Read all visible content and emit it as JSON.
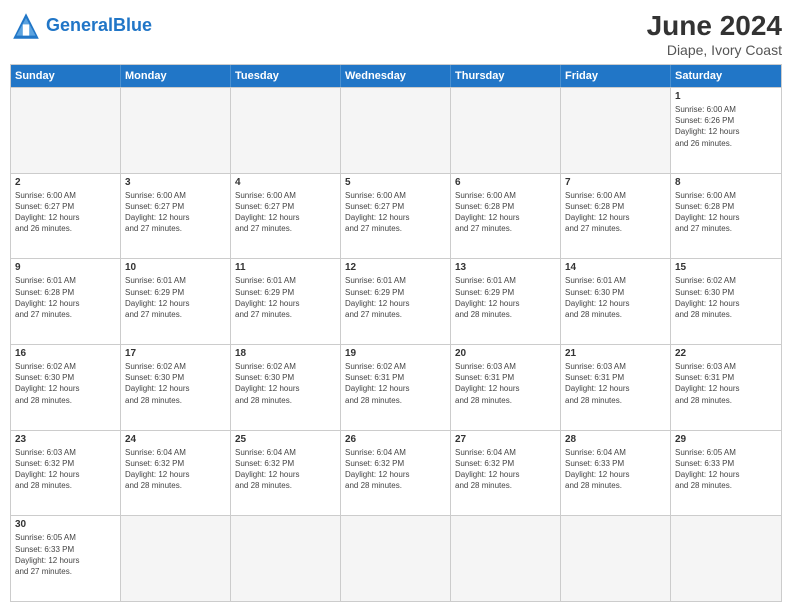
{
  "header": {
    "logo_general": "General",
    "logo_blue": "Blue",
    "title": "June 2024",
    "location": "Diape, Ivory Coast"
  },
  "days_of_week": [
    "Sunday",
    "Monday",
    "Tuesday",
    "Wednesday",
    "Thursday",
    "Friday",
    "Saturday"
  ],
  "rows": [
    {
      "cells": [
        {
          "day": "",
          "info": "",
          "empty": true
        },
        {
          "day": "",
          "info": "",
          "empty": true
        },
        {
          "day": "",
          "info": "",
          "empty": true
        },
        {
          "day": "",
          "info": "",
          "empty": true
        },
        {
          "day": "",
          "info": "",
          "empty": true
        },
        {
          "day": "",
          "info": "",
          "empty": true
        },
        {
          "day": "1",
          "info": "Sunrise: 6:00 AM\nSunset: 6:26 PM\nDaylight: 12 hours\nand 26 minutes.",
          "empty": false
        }
      ]
    },
    {
      "cells": [
        {
          "day": "2",
          "info": "Sunrise: 6:00 AM\nSunset: 6:27 PM\nDaylight: 12 hours\nand 26 minutes.",
          "empty": false
        },
        {
          "day": "3",
          "info": "Sunrise: 6:00 AM\nSunset: 6:27 PM\nDaylight: 12 hours\nand 27 minutes.",
          "empty": false
        },
        {
          "day": "4",
          "info": "Sunrise: 6:00 AM\nSunset: 6:27 PM\nDaylight: 12 hours\nand 27 minutes.",
          "empty": false
        },
        {
          "day": "5",
          "info": "Sunrise: 6:00 AM\nSunset: 6:27 PM\nDaylight: 12 hours\nand 27 minutes.",
          "empty": false
        },
        {
          "day": "6",
          "info": "Sunrise: 6:00 AM\nSunset: 6:28 PM\nDaylight: 12 hours\nand 27 minutes.",
          "empty": false
        },
        {
          "day": "7",
          "info": "Sunrise: 6:00 AM\nSunset: 6:28 PM\nDaylight: 12 hours\nand 27 minutes.",
          "empty": false
        },
        {
          "day": "8",
          "info": "Sunrise: 6:00 AM\nSunset: 6:28 PM\nDaylight: 12 hours\nand 27 minutes.",
          "empty": false
        }
      ]
    },
    {
      "cells": [
        {
          "day": "9",
          "info": "Sunrise: 6:01 AM\nSunset: 6:28 PM\nDaylight: 12 hours\nand 27 minutes.",
          "empty": false
        },
        {
          "day": "10",
          "info": "Sunrise: 6:01 AM\nSunset: 6:29 PM\nDaylight: 12 hours\nand 27 minutes.",
          "empty": false
        },
        {
          "day": "11",
          "info": "Sunrise: 6:01 AM\nSunset: 6:29 PM\nDaylight: 12 hours\nand 27 minutes.",
          "empty": false
        },
        {
          "day": "12",
          "info": "Sunrise: 6:01 AM\nSunset: 6:29 PM\nDaylight: 12 hours\nand 27 minutes.",
          "empty": false
        },
        {
          "day": "13",
          "info": "Sunrise: 6:01 AM\nSunset: 6:29 PM\nDaylight: 12 hours\nand 28 minutes.",
          "empty": false
        },
        {
          "day": "14",
          "info": "Sunrise: 6:01 AM\nSunset: 6:30 PM\nDaylight: 12 hours\nand 28 minutes.",
          "empty": false
        },
        {
          "day": "15",
          "info": "Sunrise: 6:02 AM\nSunset: 6:30 PM\nDaylight: 12 hours\nand 28 minutes.",
          "empty": false
        }
      ]
    },
    {
      "cells": [
        {
          "day": "16",
          "info": "Sunrise: 6:02 AM\nSunset: 6:30 PM\nDaylight: 12 hours\nand 28 minutes.",
          "empty": false
        },
        {
          "day": "17",
          "info": "Sunrise: 6:02 AM\nSunset: 6:30 PM\nDaylight: 12 hours\nand 28 minutes.",
          "empty": false
        },
        {
          "day": "18",
          "info": "Sunrise: 6:02 AM\nSunset: 6:30 PM\nDaylight: 12 hours\nand 28 minutes.",
          "empty": false
        },
        {
          "day": "19",
          "info": "Sunrise: 6:02 AM\nSunset: 6:31 PM\nDaylight: 12 hours\nand 28 minutes.",
          "empty": false
        },
        {
          "day": "20",
          "info": "Sunrise: 6:03 AM\nSunset: 6:31 PM\nDaylight: 12 hours\nand 28 minutes.",
          "empty": false
        },
        {
          "day": "21",
          "info": "Sunrise: 6:03 AM\nSunset: 6:31 PM\nDaylight: 12 hours\nand 28 minutes.",
          "empty": false
        },
        {
          "day": "22",
          "info": "Sunrise: 6:03 AM\nSunset: 6:31 PM\nDaylight: 12 hours\nand 28 minutes.",
          "empty": false
        }
      ]
    },
    {
      "cells": [
        {
          "day": "23",
          "info": "Sunrise: 6:03 AM\nSunset: 6:32 PM\nDaylight: 12 hours\nand 28 minutes.",
          "empty": false
        },
        {
          "day": "24",
          "info": "Sunrise: 6:04 AM\nSunset: 6:32 PM\nDaylight: 12 hours\nand 28 minutes.",
          "empty": false
        },
        {
          "day": "25",
          "info": "Sunrise: 6:04 AM\nSunset: 6:32 PM\nDaylight: 12 hours\nand 28 minutes.",
          "empty": false
        },
        {
          "day": "26",
          "info": "Sunrise: 6:04 AM\nSunset: 6:32 PM\nDaylight: 12 hours\nand 28 minutes.",
          "empty": false
        },
        {
          "day": "27",
          "info": "Sunrise: 6:04 AM\nSunset: 6:32 PM\nDaylight: 12 hours\nand 28 minutes.",
          "empty": false
        },
        {
          "day": "28",
          "info": "Sunrise: 6:04 AM\nSunset: 6:33 PM\nDaylight: 12 hours\nand 28 minutes.",
          "empty": false
        },
        {
          "day": "29",
          "info": "Sunrise: 6:05 AM\nSunset: 6:33 PM\nDaylight: 12 hours\nand 28 minutes.",
          "empty": false
        }
      ]
    },
    {
      "cells": [
        {
          "day": "30",
          "info": "Sunrise: 6:05 AM\nSunset: 6:33 PM\nDaylight: 12 hours\nand 27 minutes.",
          "empty": false
        },
        {
          "day": "",
          "info": "",
          "empty": true
        },
        {
          "day": "",
          "info": "",
          "empty": true
        },
        {
          "day": "",
          "info": "",
          "empty": true
        },
        {
          "day": "",
          "info": "",
          "empty": true
        },
        {
          "day": "",
          "info": "",
          "empty": true
        },
        {
          "day": "",
          "info": "",
          "empty": true
        }
      ]
    }
  ]
}
